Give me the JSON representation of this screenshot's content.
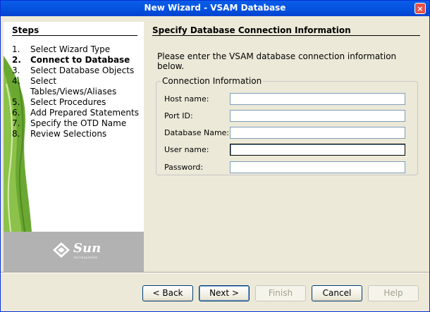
{
  "window": {
    "title": "New Wizard - VSAM Database",
    "close_label": "×"
  },
  "steps": {
    "heading": "Steps",
    "items": [
      {
        "num": "1.",
        "label": "Select Wizard Type",
        "current": false
      },
      {
        "num": "2.",
        "label": "Connect to Database",
        "current": true
      },
      {
        "num": "3.",
        "label": "Select Database Objects",
        "current": false
      },
      {
        "num": "4.",
        "label": "Select Tables/Views/Aliases",
        "current": false
      },
      {
        "num": "5.",
        "label": "Select Procedures",
        "current": false
      },
      {
        "num": "6.",
        "label": "Add Prepared Statements",
        "current": false
      },
      {
        "num": "7.",
        "label": "Specify the OTD Name",
        "current": false
      },
      {
        "num": "8.",
        "label": "Review Selections",
        "current": false
      }
    ]
  },
  "branding": {
    "logo_text": "Sun",
    "logo_subtext": "microsystems"
  },
  "content": {
    "heading": "Specify Database Connection Information",
    "intro": "Please enter the VSAM database connection information below.",
    "group_label": "Connection Information",
    "fields": {
      "host": {
        "label": "Host name:",
        "value": ""
      },
      "port": {
        "label": "Port ID:",
        "value": ""
      },
      "dbname": {
        "label": "Database Name:",
        "value": ""
      },
      "user": {
        "label": "User name:",
        "value": ""
      },
      "password": {
        "label": "Password:",
        "value": ""
      }
    }
  },
  "buttons": {
    "back": "< Back",
    "next": "Next >",
    "finish": "Finish",
    "cancel": "Cancel",
    "help": "Help"
  },
  "colors": {
    "title_bar": "#0553e0",
    "steps_bg": "#ffffff",
    "branding_bg": "#b2b2b2",
    "dialog_bg": "#ece9d8",
    "decor_green": "#6aa832"
  }
}
